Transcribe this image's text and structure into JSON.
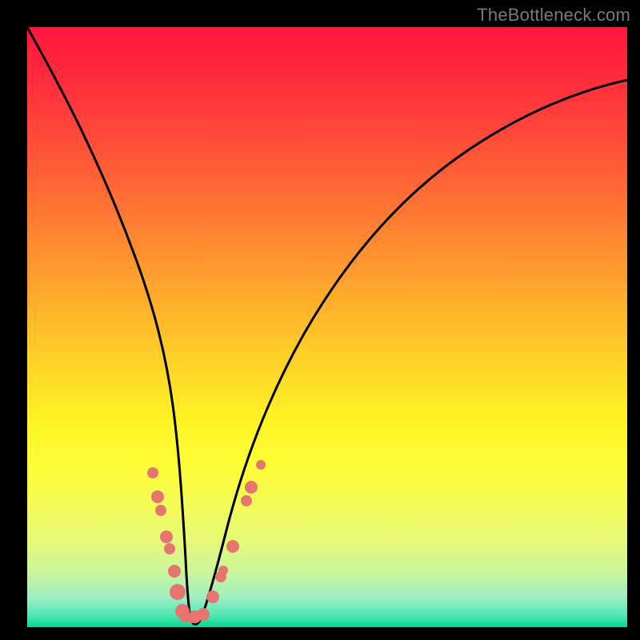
{
  "watermark": "TheBottleneck.com",
  "colors": {
    "frame": "#000000",
    "curve_stroke": "#000000",
    "dot_fill": "#e6756f",
    "gradient_top": "#ff163e",
    "gradient_bottom": "#00db8e"
  },
  "chart_data": {
    "type": "line",
    "title": "",
    "xlabel": "",
    "ylabel": "",
    "xlim": [
      0,
      100
    ],
    "ylim": [
      0,
      100
    ],
    "note": "Axes are unlabeled in the source image; x/y expressed as percentage of plot width/height with y=0 at bottom.",
    "series": [
      {
        "name": "bottleneck-curve",
        "x": [
          0,
          3,
          6,
          9,
          12,
          15,
          18,
          20,
          22,
          23.5,
          25,
          26.5,
          28,
          30,
          33,
          37,
          42,
          48,
          55,
          63,
          72,
          82,
          92,
          100
        ],
        "y": [
          100,
          89,
          78,
          67,
          56,
          45,
          35,
          27,
          19,
          12,
          6,
          2,
          1,
          2,
          7,
          15,
          25,
          36,
          47,
          57,
          66,
          74,
          80,
          84
        ]
      }
    ],
    "highlight_points": {
      "name": "highlighted-samples",
      "x": [
        20.9,
        21.8,
        22.3,
        23.2,
        23.7,
        24.5,
        25.1,
        25.9,
        26.3,
        27.4,
        28.0,
        29.4,
        30.9,
        32.3,
        32.7,
        34.3,
        36.6,
        37.4,
        39.0
      ],
      "y": [
        25.7,
        21.7,
        19.4,
        15.1,
        13.1,
        9.3,
        5.9,
        2.7,
        1.7,
        1.6,
        1.7,
        2.1,
        5.0,
        8.4,
        9.4,
        13.4,
        21.1,
        23.3,
        27.0
      ],
      "r": [
        7,
        8,
        7,
        8,
        7,
        8,
        10,
        9,
        7,
        7,
        8,
        8,
        8,
        7,
        6,
        8,
        7,
        8,
        6
      ]
    }
  }
}
